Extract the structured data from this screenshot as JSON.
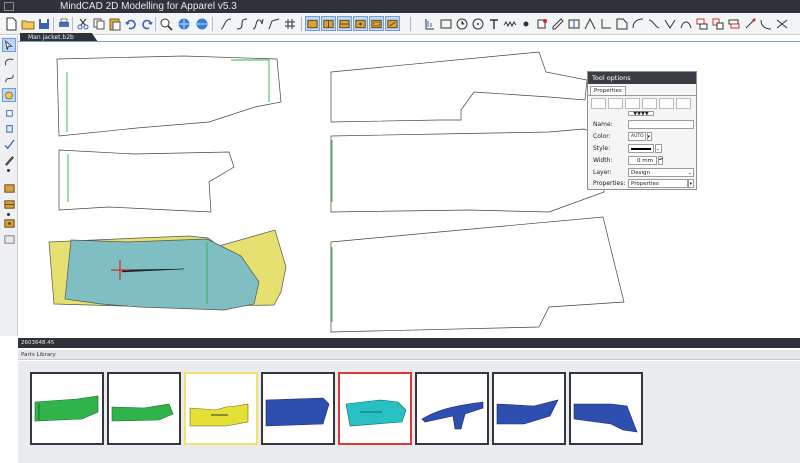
{
  "window": {
    "title": "MindCAD 2D Modelling for Apparel v5.3"
  },
  "toolbar": {
    "icons": [
      "new-file-icon",
      "open-folder-icon",
      "save-icon",
      "print-icon",
      "cut-icon",
      "copy-icon",
      "paste-icon",
      "undo-icon",
      "redo-icon",
      "zoom-icon",
      "web-icon",
      "curve-icon",
      "curve-2-icon",
      "curve-3-icon",
      "curve-4-icon",
      "grid-icon",
      "piece-tool-icon",
      "dart-tool-icon",
      "pleat-tool-icon",
      "notch-tool-icon",
      "seam-tool-icon",
      "grade-tool-icon",
      "measure-icon",
      "rectangle-icon",
      "clock-icon",
      "circle-icon",
      "text-icon",
      "zigzag-icon",
      "node-icon",
      "pin-icon",
      "piece-edit-icon",
      "split-icon",
      "mirror-icon",
      "corner-icon",
      "shape-icon",
      "corner-2-icon",
      "stack-icon",
      "layers-icon"
    ]
  },
  "document": {
    "tab_label": "Man jacket.b2b"
  },
  "tool_options": {
    "title": "Tool options",
    "tab": "Properties",
    "name_label": "Name:",
    "name_value": "",
    "color_label": "Color:",
    "color_value": "AUTO",
    "style_label": "Style:",
    "width_label": "Width:",
    "width_value": "0 mm",
    "layer_label": "Layer:",
    "layer_value": "Design",
    "properties_label": "Properties:",
    "properties_value": "Properties",
    "arrows": "▼▼▼▼"
  },
  "status_bar": {
    "text": "2603648.45"
  },
  "parts_library": {
    "title": "Parts Library",
    "tiles": [
      {
        "name": "part-1",
        "color": "#2fb34a",
        "selected": ""
      },
      {
        "name": "part-2",
        "color": "#2fb34a",
        "selected": ""
      },
      {
        "name": "part-3",
        "color": "#e5e035",
        "selected": "yellow"
      },
      {
        "name": "part-4",
        "color": "#2e4fb0",
        "selected": ""
      },
      {
        "name": "part-5",
        "color": "#28c0c0",
        "selected": "red"
      },
      {
        "name": "part-6",
        "color": "#2e4fb0",
        "selected": ""
      },
      {
        "name": "part-7",
        "color": "#2e4fb0",
        "selected": ""
      },
      {
        "name": "part-8",
        "color": "#2e4fb0",
        "selected": ""
      }
    ]
  },
  "colors": {
    "titlebar": "#2f3238",
    "accent": "#6e9fd6",
    "piece_yellow": "#e5e070",
    "piece_teal": "#7fbfc4",
    "cursor_red": "#d62828"
  }
}
